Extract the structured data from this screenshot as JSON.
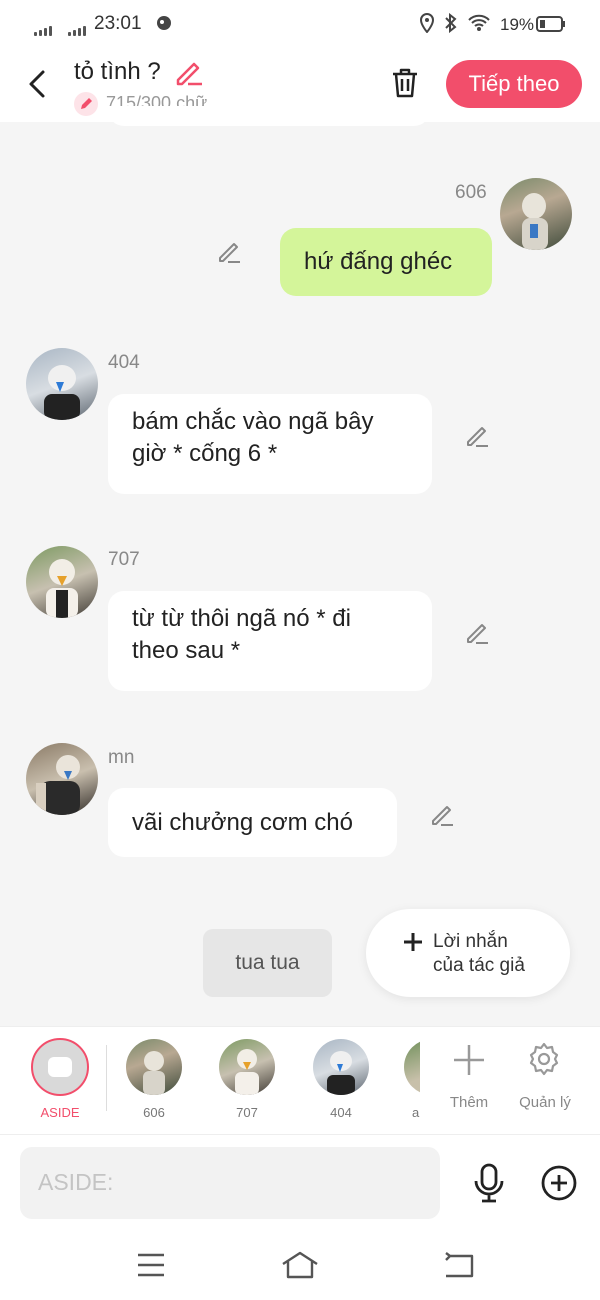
{
  "status": {
    "time": "23:01",
    "battery": "19%"
  },
  "header": {
    "title": "tỏ tình ?",
    "word_count": "715/300 chữ",
    "next_label": "Tiếp theo"
  },
  "messages": [
    {
      "sender": "606",
      "text": "hứ đấng ghéc"
    },
    {
      "sender": "404",
      "text_line1": "bám chắc vào ngã bây",
      "text_line2": "giờ * cống 6 *"
    },
    {
      "sender": "707",
      "text_line1": "từ từ thôi ngã nó * đi",
      "text_line2": "theo sau *"
    },
    {
      "sender": "mn",
      "text": "vãi chưởng cơm chó"
    }
  ],
  "narration": {
    "text": "tua tua"
  },
  "author_note": {
    "line1": "Lời nhắn",
    "line2": "của tác giả"
  },
  "characters": {
    "aside_label": "ASIDE",
    "items": [
      "606",
      "707",
      "404",
      "a"
    ],
    "add_label": "Thêm",
    "manage_label": "Quản lý"
  },
  "input": {
    "placeholder": "ASIDE:"
  },
  "colors": {
    "accent": "#f24e6b",
    "own_bubble": "#d4f59a",
    "bubble": "#ffffff",
    "background": "#f5f5f5"
  },
  "icons": [
    "back-icon",
    "edit-icon",
    "trash-icon",
    "pencil-icon",
    "plus-icon",
    "gear-icon",
    "mic-icon",
    "add-circle-icon",
    "menu-icon",
    "home-icon",
    "back-nav-icon"
  ]
}
